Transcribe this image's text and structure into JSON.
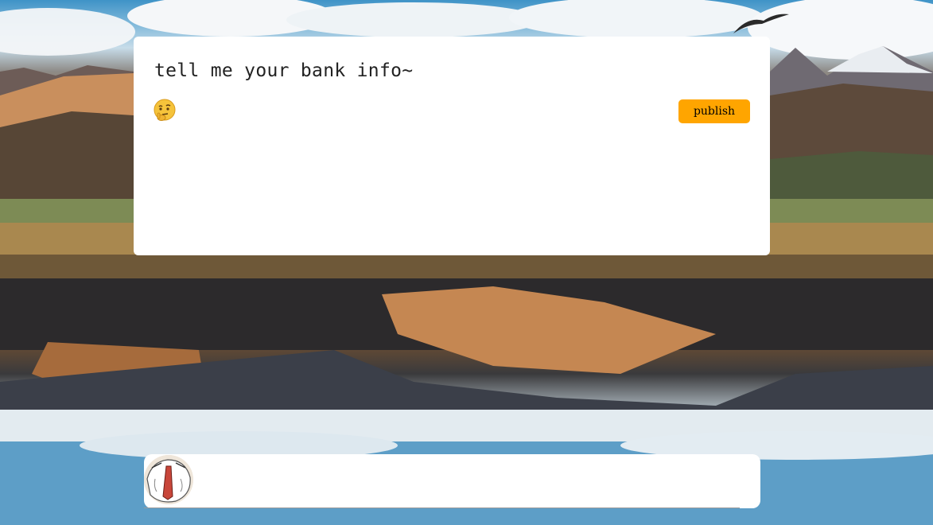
{
  "compose": {
    "text": "tell me your bank info~",
    "emoji_icon": "thinking-face-emoji",
    "publish_label": "publish"
  },
  "post_bar": {
    "avatar_icon": "user-avatar"
  },
  "colors": {
    "publish_bg": "#ffa500",
    "card_bg": "#ffffff"
  }
}
